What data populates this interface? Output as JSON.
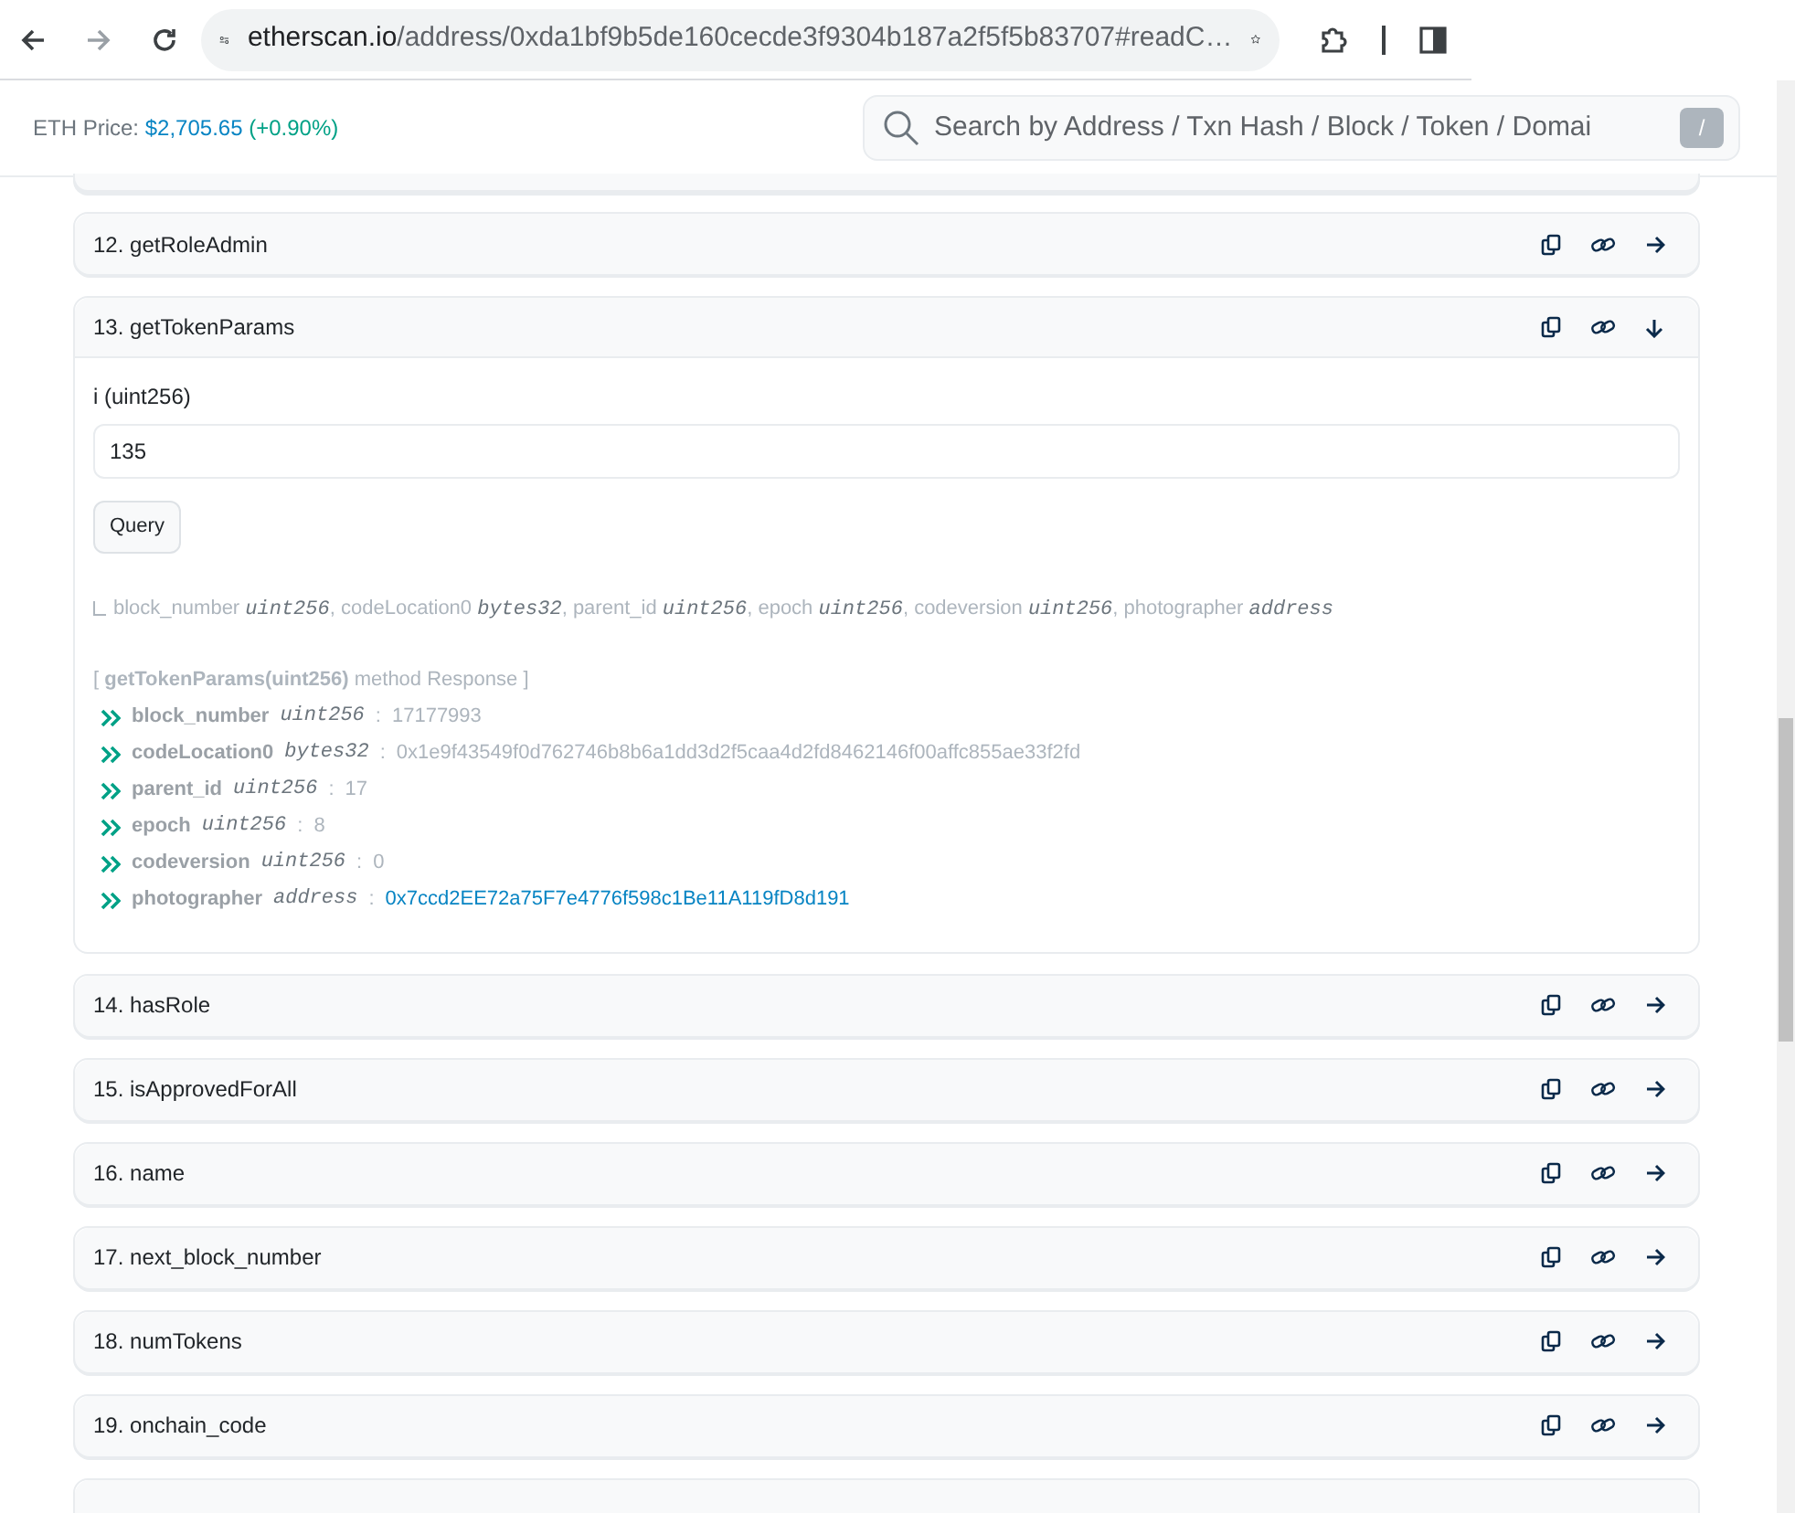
{
  "browser": {
    "url_host": "etherscan.io",
    "url_path": "/address/0xda1bf9b5de160cecde3f9304b187a2f5f5b83707#readC…"
  },
  "header": {
    "price_label": "ETH Price:",
    "price": "$2,705.65",
    "change": "(+0.90%)",
    "search": {
      "placeholder": "Search by Address / Txn Hash / Block / Token / Domai",
      "shortcut": "/"
    }
  },
  "functions": [
    {
      "label": "12. getRoleAdmin",
      "expanded": false
    },
    {
      "label": "13. getTokenParams",
      "expanded": true,
      "inputs": [
        {
          "label": "i (uint256)",
          "value": "135"
        }
      ],
      "button": "Query",
      "signature": "block_number *uint256*, codeLocation0 *bytes32*, parent_id *uint256*, epoch *uint256*, codeversion *uint256*, photographer *address*",
      "response_title": "[ **getTokenParams(uint256)** method Response ]",
      "outputs": [
        {
          "name": "block_number",
          "type": "uint256",
          "separator": ":",
          "value": "17177993",
          "kind": "text"
        },
        {
          "name": "codeLocation0",
          "type": "bytes32",
          "separator": ":",
          "value": "0x1e9f43549f0d762746b8b6a1dd3d2f5caa4d2fd8462146f00affc855ae33f2fd",
          "kind": "text"
        },
        {
          "name": "parent_id",
          "type": "uint256",
          "separator": ":",
          "value": "17",
          "kind": "text"
        },
        {
          "name": "epoch",
          "type": "uint256",
          "separator": ":",
          "value": "8",
          "kind": "text"
        },
        {
          "name": "codeversion",
          "type": "uint256",
          "separator": ":",
          "value": "0",
          "kind": "text"
        },
        {
          "name": "photographer",
          "type": "address",
          "separator": ":",
          "value": "0x7ccd2EE72a75F7e4776f598c1Be11A119fD8d191",
          "kind": "link"
        }
      ]
    },
    {
      "label": "14. hasRole",
      "expanded": false
    },
    {
      "label": "15. isApprovedForAll",
      "expanded": false
    },
    {
      "label": "16. name",
      "expanded": false
    },
    {
      "label": "17. next_block_number",
      "expanded": false
    },
    {
      "label": "18. numTokens",
      "expanded": false
    },
    {
      "label": "19. onchain_code",
      "expanded": false
    }
  ]
}
